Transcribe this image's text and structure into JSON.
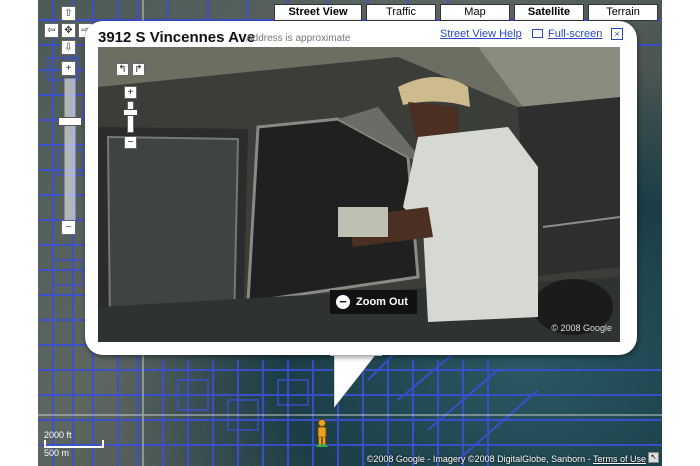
{
  "map": {
    "types": [
      {
        "label": "Street View",
        "active": true
      },
      {
        "label": "Traffic",
        "active": false
      },
      {
        "label": "Map",
        "active": false
      },
      {
        "label": "Satellite",
        "active": true
      },
      {
        "label": "Terrain",
        "active": false
      }
    ],
    "scale": {
      "top": "2000 ft",
      "bottom": "500 m"
    },
    "copyright": "©2008 Google - Imagery ©2008 DigitalGlobe, Sanborn - ",
    "terms_label": "Terms of Use"
  },
  "nav": {
    "up": "⇧",
    "down": "⇩",
    "left": "⇦",
    "right": "⇨",
    "center": "✥",
    "zoom_in": "+",
    "zoom_out": "−"
  },
  "info_window": {
    "address": "3912 S Vincennes Ave",
    "approx_note": "Address is approximate",
    "help_link": "Street View Help",
    "fullscreen_link": "Full-screen",
    "close": "×"
  },
  "panorama": {
    "rotate_left": "↰",
    "rotate_right": "↱",
    "zoom_in": "+",
    "zoom_out": "−",
    "zoom_out_button": "Zoom Out",
    "copyright": "© 2008 Google"
  },
  "colors": {
    "street_line": "#3c4fd6",
    "link": "#2a49c8"
  }
}
